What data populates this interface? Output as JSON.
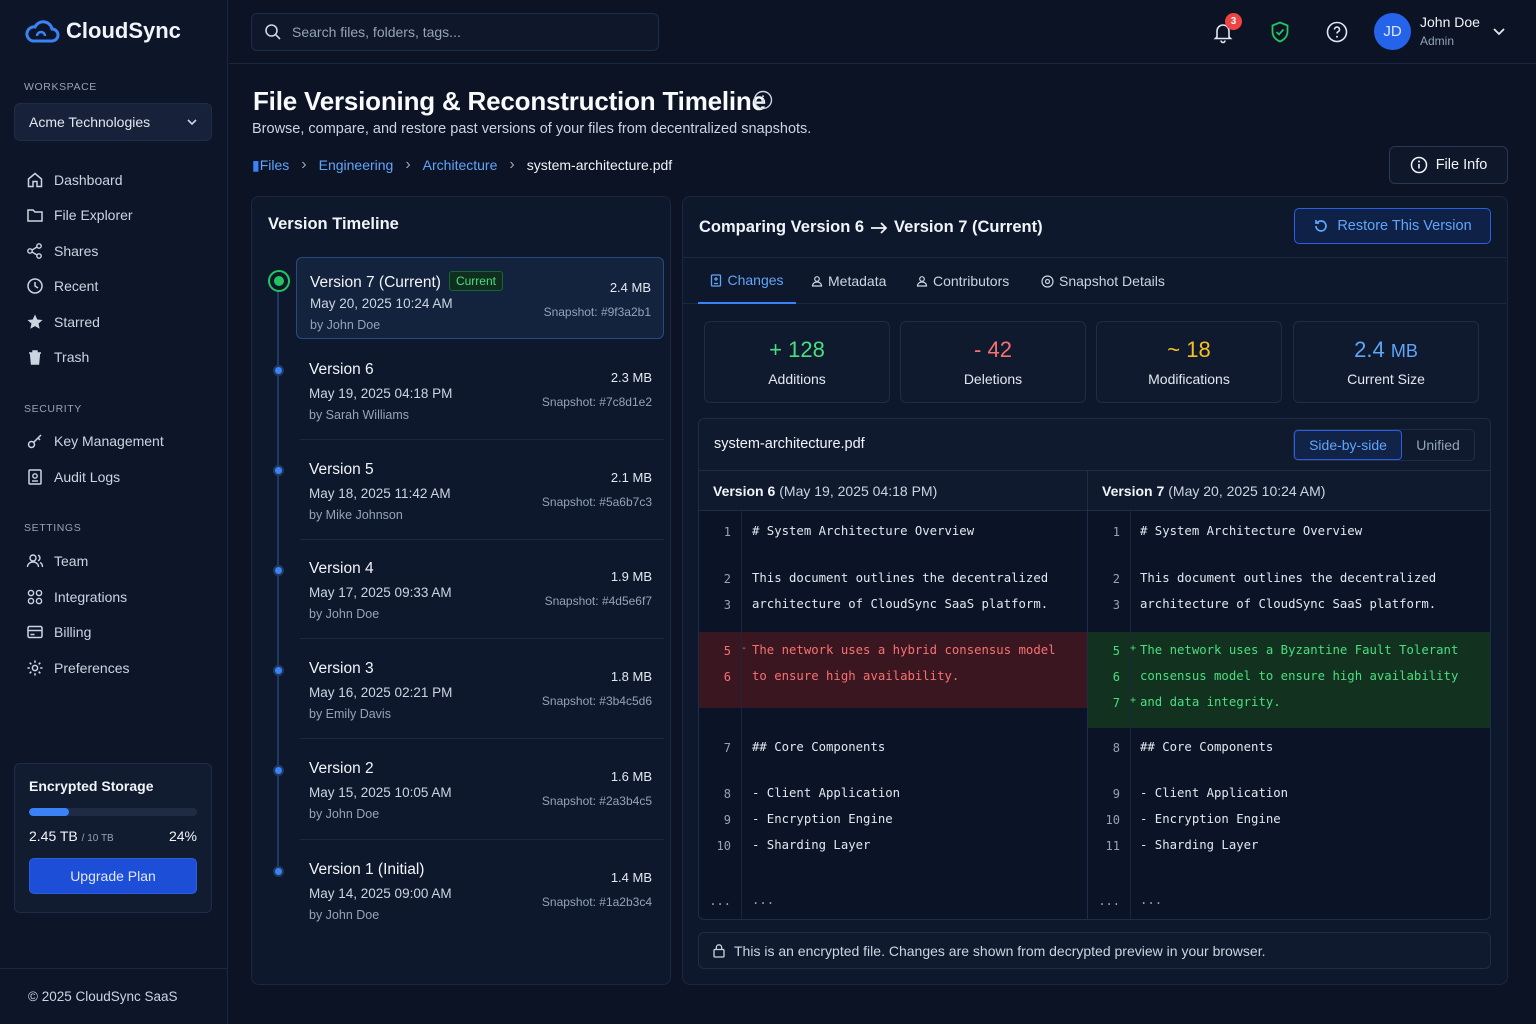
{
  "app": {
    "name": "CloudSync"
  },
  "sidebar": {
    "workspace_label": "WORKSPACE",
    "workspace_name": "Acme Technologies",
    "main_items": [
      {
        "label": "Dashboard",
        "icon": "home-icon"
      },
      {
        "label": "File Explorer",
        "icon": "folder-icon"
      },
      {
        "label": "Shares",
        "icon": "share-icon"
      },
      {
        "label": "Recent",
        "icon": "clock-icon"
      },
      {
        "label": "Starred",
        "icon": "star-icon"
      },
      {
        "label": "Trash",
        "icon": "trash-icon"
      }
    ],
    "security_label": "SECURITY",
    "security_items": [
      {
        "label": "Key Management",
        "icon": "key-icon"
      },
      {
        "label": "Audit Logs",
        "icon": "log-icon"
      }
    ],
    "settings_label": "SETTINGS",
    "settings_items": [
      {
        "label": "Team",
        "icon": "users-icon"
      },
      {
        "label": "Integrations",
        "icon": "grid-icon"
      },
      {
        "label": "Billing",
        "icon": "card-icon"
      },
      {
        "label": "Preferences",
        "icon": "gear-icon"
      }
    ],
    "storage": {
      "title": "Encrypted Storage",
      "used": "2.45 TB",
      "total": "/ 10 TB",
      "percent": "24%",
      "fraction": 0.24,
      "upgrade_label": "Upgrade Plan"
    },
    "copyright": "© 2025 CloudSync SaaS"
  },
  "topbar": {
    "search_placeholder": "Search files, folders, tags...",
    "notification_count": "3",
    "user_initials": "JD",
    "user_name": "John Doe",
    "user_role": "Admin"
  },
  "page": {
    "title": "File Versioning & Reconstruction Timeline",
    "subtitle": "Browse, compare, and restore past versions of your files from decentralized snapshots.",
    "breadcrumb": [
      "Files",
      "Engineering",
      "Architecture",
      "system-architecture.pdf"
    ],
    "file_info_label": "File Info"
  },
  "timeline": {
    "title": "Version Timeline",
    "current_badge": "Current",
    "versions": [
      {
        "name": "Version 7 (Current)",
        "date": "May 20, 2025 10:24 AM",
        "by": "by John Doe",
        "size": "2.4 MB",
        "snapshot": "Snapshot: #9f3a2b1"
      },
      {
        "name": "Version 6",
        "date": "May 19, 2025 04:18 PM",
        "by": "by Sarah Williams",
        "size": "2.3 MB",
        "snapshot": "Snapshot: #7c8d1e2"
      },
      {
        "name": "Version 5",
        "date": "May 18, 2025 11:42 AM",
        "by": "by Mike Johnson",
        "size": "2.1 MB",
        "snapshot": "Snapshot: #5a6b7c3"
      },
      {
        "name": "Version 4",
        "date": "May 17, 2025 09:33 AM",
        "by": "by John Doe",
        "size": "1.9 MB",
        "snapshot": "Snapshot: #4d5e6f7"
      },
      {
        "name": "Version 3",
        "date": "May 16, 2025 02:21 PM",
        "by": "by Emily Davis",
        "size": "1.8 MB",
        "snapshot": "Snapshot: #3b4c5d6"
      },
      {
        "name": "Version 2",
        "date": "May 15, 2025 10:05 AM",
        "by": "by John Doe",
        "size": "1.6 MB",
        "snapshot": "Snapshot: #2a3b4c5"
      },
      {
        "name": "Version 1 (Initial)",
        "date": "May 14, 2025 09:00 AM",
        "by": "by John Doe",
        "size": "1.4 MB",
        "snapshot": "Snapshot: #1a2b3c4"
      }
    ]
  },
  "compare": {
    "title_left": "Comparing Version 6",
    "title_right": "Version 7 (Current)",
    "restore_label": "Restore This Version",
    "tabs": [
      "Changes",
      "Metadata",
      "Contributors",
      "Snapshot Details"
    ],
    "stats": [
      {
        "prefix": "+",
        "value": "128",
        "label": "Additions",
        "color": "#4ade80"
      },
      {
        "prefix": "-",
        "value": "42",
        "label": "Deletions",
        "color": "#f87171"
      },
      {
        "prefix": "~",
        "value": "18",
        "label": "Modifications",
        "color": "#fbbf24"
      },
      {
        "prefix": "",
        "value": "2.4",
        "unit": "MB",
        "label": "Current Size",
        "color": "#60a5fa"
      }
    ],
    "diff": {
      "filename": "system-architecture.pdf",
      "view_side": "Side-by-side",
      "view_unified": "Unified",
      "left_version": "Version 6",
      "left_date": "(May 19, 2025 04:18 PM)",
      "right_version": "Version 7",
      "right_date": "(May 20, 2025 10:24 AM)",
      "left_lines": [
        {
          "n": "1",
          "text": "# System Architecture Overview"
        },
        {
          "n": "2",
          "text": "This document outlines the decentralized"
        },
        {
          "n": "3",
          "text": "architecture of CloudSync SaaS platform."
        },
        {
          "n": "5",
          "text": "The network uses a hybrid consensus model",
          "mark": "-"
        },
        {
          "n": "6",
          "text": "to ensure high availability."
        },
        {
          "n": "7",
          "text": "## Core Components"
        },
        {
          "n": "8",
          "text": "- Client Application"
        },
        {
          "n": "9",
          "text": "- Encryption Engine"
        },
        {
          "n": "10",
          "text": "- Sharding Layer"
        },
        {
          "n": "...",
          "text": "..."
        }
      ],
      "right_lines": [
        {
          "n": "1",
          "text": "# System Architecture Overview"
        },
        {
          "n": "2",
          "text": "This document outlines the decentralized"
        },
        {
          "n": "3",
          "text": "architecture of CloudSync SaaS platform."
        },
        {
          "n": "5",
          "text": "The network uses a Byzantine Fault Tolerant",
          "mark": "+"
        },
        {
          "n": "6",
          "text": "consensus model to ensure high availability"
        },
        {
          "n": "7",
          "text": "and data integrity.",
          "mark": "+"
        },
        {
          "n": "8",
          "text": "## Core Components"
        },
        {
          "n": "9",
          "text": "- Client Application"
        },
        {
          "n": "10",
          "text": "- Encryption Engine"
        },
        {
          "n": "11",
          "text": "- Sharding Layer"
        },
        {
          "n": "...",
          "text": "..."
        }
      ]
    },
    "notice": "This is an encrypted file. Changes are shown from decrypted preview in your browser."
  }
}
